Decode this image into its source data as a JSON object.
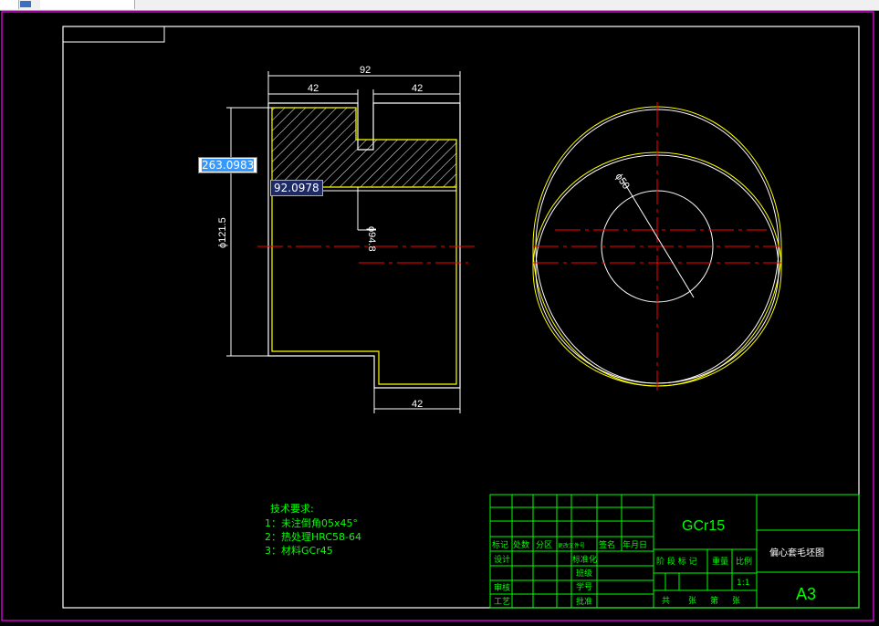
{
  "dims": {
    "overall": "92",
    "left": "42",
    "right": "42",
    "bottom": "42",
    "dia_outer": "ϕ121.5",
    "dia_inner": "ϕ94.8",
    "circle_dia": "ϕ50"
  },
  "dynamic_input": {
    "distance": "263.0983",
    "angle": "92.0978"
  },
  "notes": {
    "title": "技术要求:",
    "items": [
      "1：未注倒角05x45°",
      "2：热处理HRC58-64",
      "3：材料GCr45"
    ]
  },
  "title_block": {
    "material": "GCr15",
    "drawing_name": "偏心套毛坯图",
    "sheet": "A3",
    "scale": "1:1",
    "header_cols": [
      "标记",
      "处数",
      "分区",
      "更改文件号",
      "签名",
      "年月日"
    ],
    "left_labels": {
      "design": "设计",
      "review": "审核",
      "process": "工艺"
    },
    "mid_labels": {
      "standard": "标准化",
      "class": "班级",
      "student_no": "学号",
      "approve": "批准"
    },
    "right_header": [
      "阶 段 标 记",
      "重量",
      "比例"
    ],
    "sheet_count": [
      "共",
      "张",
      "第",
      "张"
    ]
  },
  "colors": {
    "outline": "#ffffff",
    "part": "#ffff00",
    "center": "#ff0000",
    "table": "#00ff00",
    "frame": "#ff00ff"
  }
}
